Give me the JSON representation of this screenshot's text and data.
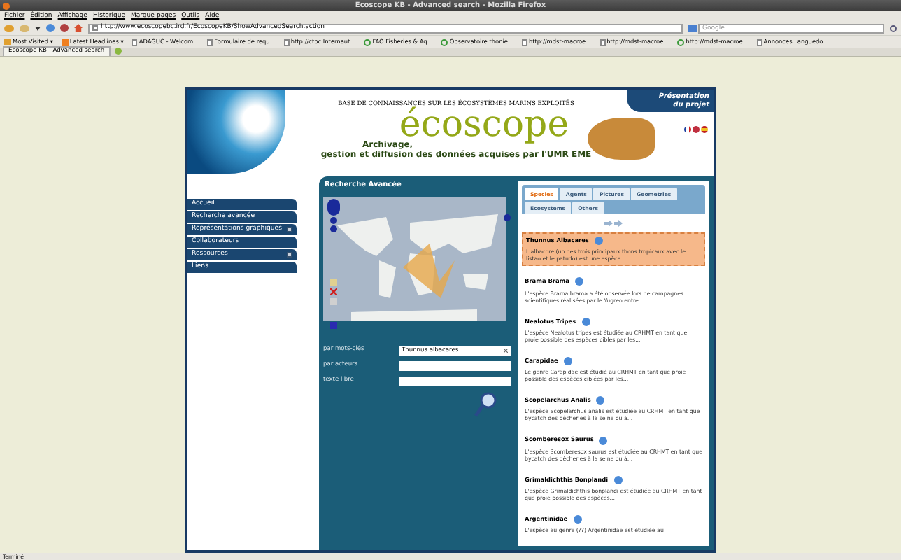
{
  "window": {
    "title": "Ecoscope KB - Advanced search - Mozilla Firefox"
  },
  "menu_bar": [
    "Fichier",
    "Édition",
    "Affichage",
    "Historique",
    "Marque-pages",
    "Outils",
    "Aide"
  ],
  "address_bar": {
    "url": "http://www.ecoscopebc.ird.fr/EcoscopeKB/ShowAdvancedSearch.action"
  },
  "search_bar": {
    "placeholder": "Google"
  },
  "bookmarks": [
    {
      "label": "Most Visited ▾",
      "kind": "folder"
    },
    {
      "label": "Latest Headlines ▾",
      "kind": "feed"
    },
    {
      "label": "ADAGUC - Welcom...",
      "kind": "page"
    },
    {
      "label": "Formulaire de requ...",
      "kind": "page"
    },
    {
      "label": "http://ctbc.Internaut...",
      "kind": "page"
    },
    {
      "label": "FAO Fisheries & Aq...",
      "kind": "globe"
    },
    {
      "label": "Observatoire thonie...",
      "kind": "globe"
    },
    {
      "label": "http://mdst-macroe...",
      "kind": "page"
    },
    {
      "label": "http://mdst-macroe...",
      "kind": "page"
    },
    {
      "label": "http://mdst-macroe...",
      "kind": "globe"
    },
    {
      "label": "Annonces Languedo...",
      "kind": "page"
    }
  ],
  "browser_tabs": [
    {
      "label": "Ecoscope KB - Advanced search",
      "selected": true
    }
  ],
  "header": {
    "tagline": "BASE DE CONNAISSANCES SUR LES ÉCOSYSTÈMES MARINS EXPLOITÉS",
    "logo": "écoscope",
    "subtitle_1": "Archivage,",
    "subtitle_2": "gestion et diffusion des données acquises par l'UMR EME",
    "project_link": "Présentation du projet"
  },
  "nav_menu": [
    {
      "label": "Accueil",
      "expandable": false
    },
    {
      "label": "Recherche avancée",
      "expandable": false
    },
    {
      "label": "Représentations graphiques",
      "expandable": true
    },
    {
      "label": "Collaborateurs",
      "expandable": false
    },
    {
      "label": "Ressources",
      "expandable": true
    },
    {
      "label": "Liens",
      "expandable": false
    }
  ],
  "search_panel": {
    "title": "Recherche Avancée",
    "fields": [
      {
        "label": "par mots-clés",
        "value": "Thunnus albacares"
      },
      {
        "label": "par acteurs"
      },
      {
        "label": "texte libre"
      }
    ]
  },
  "result_tabs": [
    {
      "label": "Species",
      "selected": true
    },
    {
      "label": "Agents",
      "selected": false
    },
    {
      "label": "Pictures",
      "selected": false
    },
    {
      "label": "Geometries",
      "selected": false
    },
    {
      "label": "Ecosystems",
      "selected": false
    },
    {
      "label": "Others",
      "selected": false
    }
  ],
  "results": [
    {
      "title": "Thunnus Albacares",
      "text": "L'albacore (un des trois principaux thons tropicaux avec le listao et le patudo) est une espèce...",
      "selected": true
    },
    {
      "title": "Brama Brama",
      "text": "L'espèce Brama brama a été observée lors de campagnes scientifiques réalisées par le Yugreo entre...",
      "selected": false
    },
    {
      "title": "Nealotus Tripes",
      "text": "L'espèce Nealotus tripes est étudiée au CRHMT en tant que proie possible des espèces cibles par les...",
      "selected": false
    },
    {
      "title": "Carapidae",
      "text": "Le genre Carapidae est étudié au CRHMT en tant que proie possible des espèces ciblées par les...",
      "selected": false
    },
    {
      "title": "Scopelarchus Analis",
      "text": "L'espèce Scopelarchus analis est étudiée au CRHMT en tant que bycatch des pêcheries à la seine ou à...",
      "selected": false
    },
    {
      "title": "Scomberesox Saurus",
      "text": "L'espèce Scomberesox saurus est étudiée au CRHMT en tant que bycatch des pêcheries à la seine ou à...",
      "selected": false
    },
    {
      "title": "Grimaldichthis Bonplandi",
      "text": "L'espèce Grimaldichthis bonplandi est étudiée au CRHMT en tant que proie possible des espèces...",
      "selected": false
    },
    {
      "title": "Argentinidae",
      "text": "L'espèce au genre (??) Argentinidae est étudiée au",
      "selected": false
    }
  ],
  "status_bar": {
    "text": "Terminé"
  }
}
